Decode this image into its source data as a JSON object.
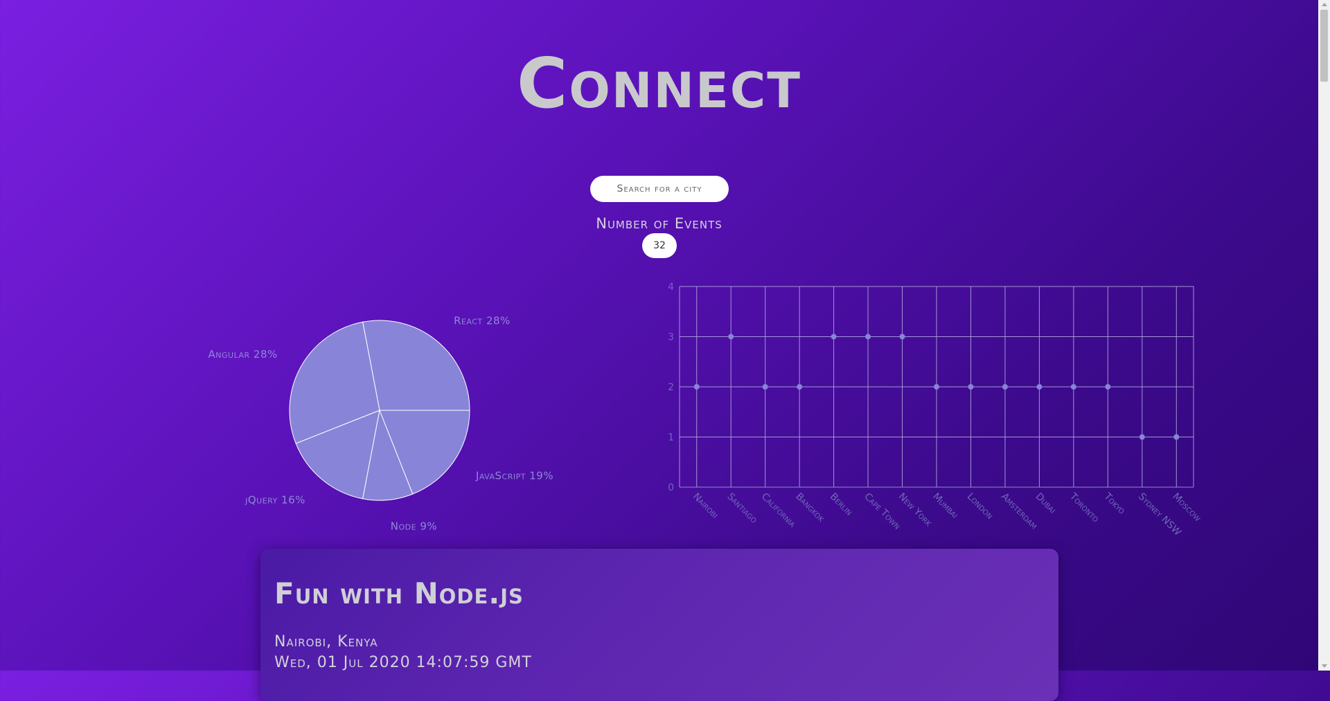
{
  "app": {
    "title": "Connect"
  },
  "search": {
    "placeholder": "Search for a city"
  },
  "events": {
    "label": "Number of Events",
    "value": "32"
  },
  "chart_data": [
    {
      "type": "pie",
      "slices": [
        {
          "label": "React",
          "value": 28,
          "text": "React 28%"
        },
        {
          "label": "Angular",
          "value": 28,
          "text": "Angular 28%"
        },
        {
          "label": "jQuery",
          "value": 16,
          "text": "jQuery 16%"
        },
        {
          "label": "Node",
          "value": 9,
          "text": "Node 9%"
        },
        {
          "label": "JavaScript",
          "value": 19,
          "text": "JavaScript 19%"
        }
      ],
      "fill_color": "#8884d8",
      "stroke_color": "#ffffff"
    },
    {
      "type": "scatter",
      "categories": [
        "Nairobi",
        "Santiago",
        "California",
        "Bangkok",
        "Berlin",
        "Cape Town",
        "New York",
        "Mumbai",
        "London",
        "Amsterdam",
        "Dubai",
        "Toronto",
        "Tokyo",
        "Sydney NSW",
        "Moscow"
      ],
      "values": [
        2,
        3,
        2,
        2,
        3,
        3,
        3,
        2,
        2,
        2,
        2,
        2,
        2,
        1,
        1
      ],
      "ylim": [
        0,
        4
      ],
      "yticks": [
        0,
        1,
        2,
        3,
        4
      ],
      "grid": true,
      "point_color": "#8884d8"
    }
  ],
  "event_card": {
    "title": "Fun with Node.js",
    "location": "Nairobi, Kenya",
    "date": "Wed, 01 Jul 2020 14:07:59 GMT"
  }
}
